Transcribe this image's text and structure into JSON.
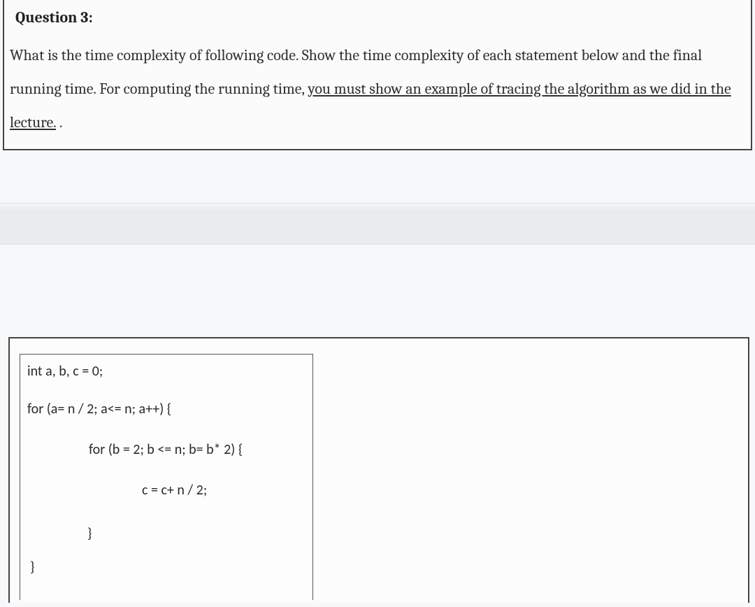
{
  "question": {
    "label": "Question 3:",
    "text_plain": "What is the time complexity of following code. Show the time complexity of each statement below and the final running time.  For computing the running time, ",
    "text_underlined": "you must show an example of tracing the algorithm as we did in the lecture.",
    "text_trailing": "   ."
  },
  "code": {
    "line1": "int a, b, c = 0;",
    "line2": "for (a= n / 2; a<= n; a++) {",
    "line3": "for (b = 2; b <= n; b= b* 2) {",
    "line4": "c = c+ n / 2;",
    "line5": "}",
    "line6": "}"
  }
}
